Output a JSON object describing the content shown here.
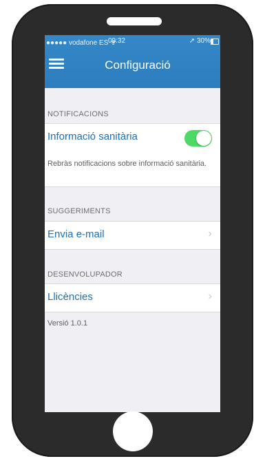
{
  "status_bar": {
    "carrier": "●●●●● vodafone ES ᯤ",
    "time": "09:32",
    "battery": "➚ 30%"
  },
  "navbar": {
    "title": "Configuració"
  },
  "notifications": {
    "header": "NOTIFICACIONS",
    "label": "Informació sanitària",
    "toggle_on": true,
    "toggle_color": "#4cd964",
    "footer": "Rebràs notificacions sobre informació sanitària."
  },
  "suggestions": {
    "header": "SUGGERIMENTS",
    "label": "Envia e-mail"
  },
  "developer": {
    "header": "DESENVOLUPADOR",
    "label": "Llicències",
    "version": "Versió 1.0.1"
  },
  "chevron": "›",
  "colors": {
    "accent": "#2c7dbd",
    "link": "#1f6fb4",
    "background": "#efeff4"
  }
}
